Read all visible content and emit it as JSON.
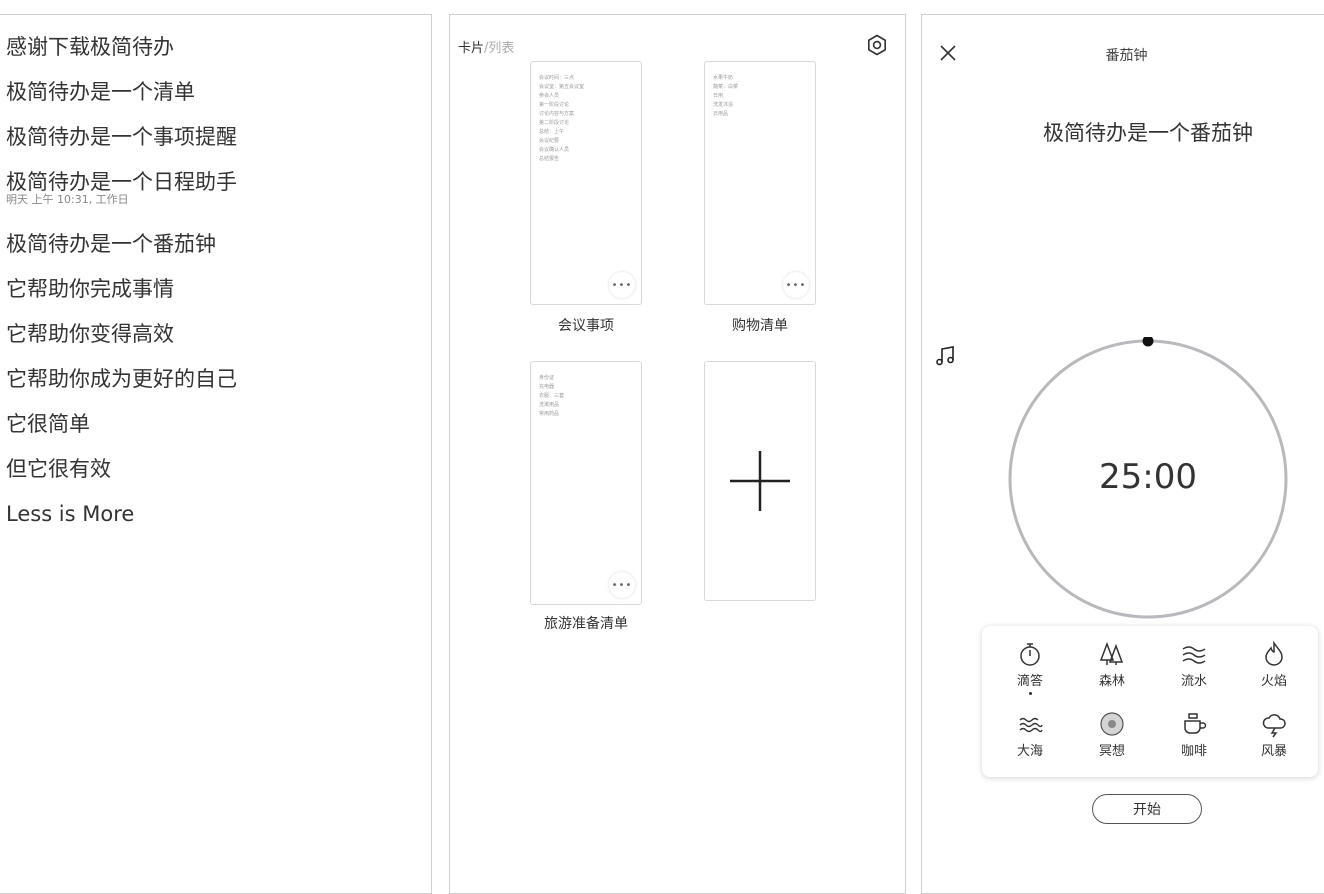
{
  "list_panel": {
    "items": [
      {
        "text": "感谢下载极简待办"
      },
      {
        "text": "极简待办是一个清单"
      },
      {
        "text": "极简待办是一个事项提醒"
      },
      {
        "text": "极简待办是一个日程助手",
        "sub": "明天 上午 10:31, 工作日"
      },
      {
        "text": "极简待办是一个番茄钟"
      },
      {
        "text": "它帮助你完成事情"
      },
      {
        "text": "它帮助你变得高效"
      },
      {
        "text": "它帮助你成为更好的自己"
      },
      {
        "text": "它很简单"
      },
      {
        "text": "但它很有效"
      },
      {
        "text": "Less is More"
      }
    ]
  },
  "cards_panel": {
    "header_active": "卡片",
    "header_sep": "/",
    "header_inactive": "列表",
    "more_label": "•••",
    "cards": [
      {
        "title": "会议事项",
        "lines": [
          "会议时间：三点",
          "会议室：第五会议室",
          "参会人员",
          "第一阶段讨论",
          "讨论内容与方案",
          "第二阶段讨论",
          "总结：上午",
          "会议纪要",
          "会议确认人员",
          "总结报告"
        ]
      },
      {
        "title": "购物清单",
        "lines": [
          "水果牛奶",
          "蔬菜：白菜",
          "日用",
          "洗发沐浴",
          "日用品"
        ]
      },
      {
        "title": "旅游准备清单",
        "lines": [
          "身份证",
          "充电器",
          "衣服：三套",
          "洗漱用品",
          "常用药品"
        ]
      }
    ]
  },
  "pomodoro": {
    "title": "番茄钟",
    "task": "极简待办是一个番茄钟",
    "time": "25:00",
    "progress": 0,
    "sounds": [
      {
        "label": "滴答",
        "icon": "stopwatch-icon",
        "selected": true
      },
      {
        "label": "森林",
        "icon": "forest-icon",
        "selected": false
      },
      {
        "label": "流水",
        "icon": "water-icon",
        "selected": false
      },
      {
        "label": "火焰",
        "icon": "flame-icon",
        "selected": false
      },
      {
        "label": "大海",
        "icon": "ocean-icon",
        "selected": false
      },
      {
        "label": "冥想",
        "icon": "meditation-icon",
        "selected": false
      },
      {
        "label": "咖啡",
        "icon": "coffee-icon",
        "selected": false
      },
      {
        "label": "风暴",
        "icon": "storm-icon",
        "selected": false
      }
    ],
    "start_label": "开始"
  }
}
